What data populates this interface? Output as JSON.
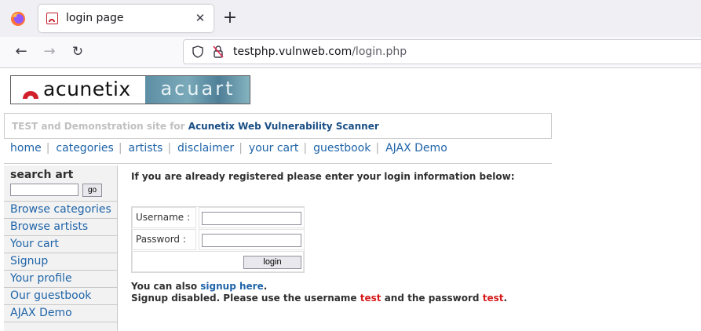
{
  "browser": {
    "tab_title": "login page",
    "url_domain": "testphp.vulnweb.com",
    "url_path": "/login.php"
  },
  "logo": {
    "left_text": "acunetix",
    "right_text": "acuart"
  },
  "tagline": {
    "prefix": "TEST and Demonstration site for",
    "highlight": "Acunetix Web Vulnerability Scanner"
  },
  "topnav": [
    "home",
    "categories",
    "artists",
    "disclaimer",
    "your cart",
    "guestbook",
    "AJAX Demo"
  ],
  "sidebar": {
    "search_title": "search art",
    "search_value": "",
    "go_label": "go",
    "items": [
      "Browse categories",
      "Browse artists",
      "Your cart",
      "Signup",
      "Your profile",
      "Our guestbook",
      "AJAX Demo"
    ]
  },
  "login": {
    "intro": "If you are already registered please enter your login information below:",
    "username_label": "Username :",
    "password_label": "Password :",
    "username_value": "",
    "password_value": "",
    "button_label": "login"
  },
  "signup": {
    "line1_prefix": "You can also",
    "line1_link": "signup here",
    "line1_suffix": ".",
    "line2_prefix": "Signup disabled. Please use the username",
    "username": "test",
    "line2_mid": "and the password",
    "password": "test",
    "line2_suffix": "."
  },
  "colors": {
    "link": "#1f64a8",
    "credential_red": "#d61b1b",
    "tagline_highlight": "#1a4f85"
  }
}
